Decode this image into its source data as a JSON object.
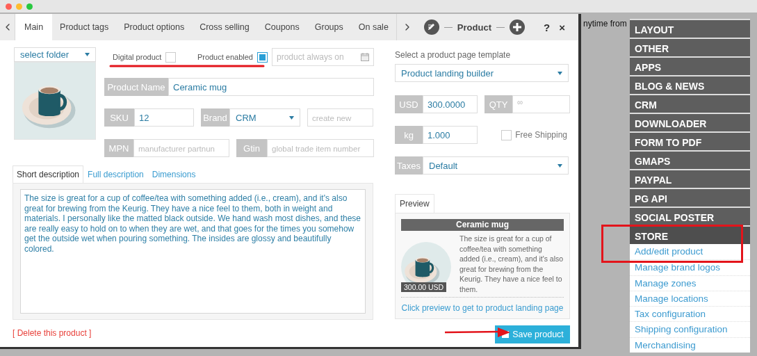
{
  "background_text": "nytime from",
  "dialog": {
    "tabs": [
      {
        "label": "Main",
        "selected": true
      },
      {
        "label": "Product tags",
        "selected": false
      },
      {
        "label": "Product options",
        "selected": false
      },
      {
        "label": "Cross selling",
        "selected": false
      },
      {
        "label": "Coupons",
        "selected": false
      },
      {
        "label": "Groups",
        "selected": false
      },
      {
        "label": "On sale",
        "selected": false
      }
    ],
    "title": "Product",
    "help": "?",
    "close": "×",
    "folder_select": "select folder",
    "digital_product": {
      "label": "Digital product",
      "checked": false
    },
    "product_enabled": {
      "label": "Product enabled",
      "checked": true
    },
    "availability": {
      "placeholder": "product always on"
    },
    "product_name": {
      "label": "Product Name",
      "value": "Ceramic mug"
    },
    "sku": {
      "label": "SKU",
      "value": "12"
    },
    "brand": {
      "label": "Brand",
      "value": "CRM",
      "new_placeholder": "create new"
    },
    "mpn": {
      "label": "MPN",
      "placeholder": "manufacturer partnun"
    },
    "gtin": {
      "label": "Gtin",
      "placeholder": "global trade item number"
    },
    "description_tabs": [
      {
        "label": "Short description",
        "selected": true
      },
      {
        "label": "Full description",
        "selected": false
      },
      {
        "label": "Dimensions",
        "selected": false
      }
    ],
    "description": "The size is great for a cup of coffee/tea with something added (i.e., cream), and it's also great for brewing from the Keurig. They have a nice feel to them, both in weight and materials. I personally like the matted black outside. We hand wash most dishes, and these are really easy to hold on to when they are wet, and that goes for the times you somehow get the outside wet when pouring something. The insides are glossy and beautifully colored.",
    "delete_link": "[ Delete this product ]",
    "template_label": "Select a product page template",
    "template": "Product landing builder",
    "price": {
      "label": "USD",
      "value": "300.0000"
    },
    "qty": {
      "label": "QTY",
      "placeholder": "∞"
    },
    "weight": {
      "label": "kg",
      "value": "1.000"
    },
    "free_shipping": {
      "label": "Free Shipping",
      "checked": false
    },
    "taxes": {
      "label": "Taxes",
      "value": "Default"
    },
    "preview": {
      "tab": "Preview",
      "title": "Ceramic mug",
      "price": "300.00 USD",
      "text": "The size is great for a cup of coffee/tea with something added (i.e., cream), and it's also great for brewing from the Keurig. They have a nice feel to them.",
      "link": "Click preview to get to product landing page"
    },
    "save_button": "Save product"
  },
  "menu": [
    {
      "label": "LAYOUT",
      "expanded": false
    },
    {
      "label": "OTHER",
      "expanded": false
    },
    {
      "label": "APPS",
      "expanded": false
    },
    {
      "label": "BLOG & NEWS",
      "expanded": false
    },
    {
      "label": "CRM",
      "expanded": false
    },
    {
      "label": "DOWNLOADER",
      "expanded": false
    },
    {
      "label": "FORM TO PDF",
      "expanded": false
    },
    {
      "label": "GMAPS",
      "expanded": false
    },
    {
      "label": "PAYPAL",
      "expanded": false
    },
    {
      "label": "PG API",
      "expanded": false
    },
    {
      "label": "SOCIAL POSTER",
      "expanded": false
    },
    {
      "label": "STORE",
      "expanded": true,
      "items": [
        "Add/edit product",
        "Manage brand logos",
        "Manage zones",
        "Manage locations",
        "Tax configuration",
        "Shipping configuration",
        "Merchandising"
      ]
    }
  ]
}
